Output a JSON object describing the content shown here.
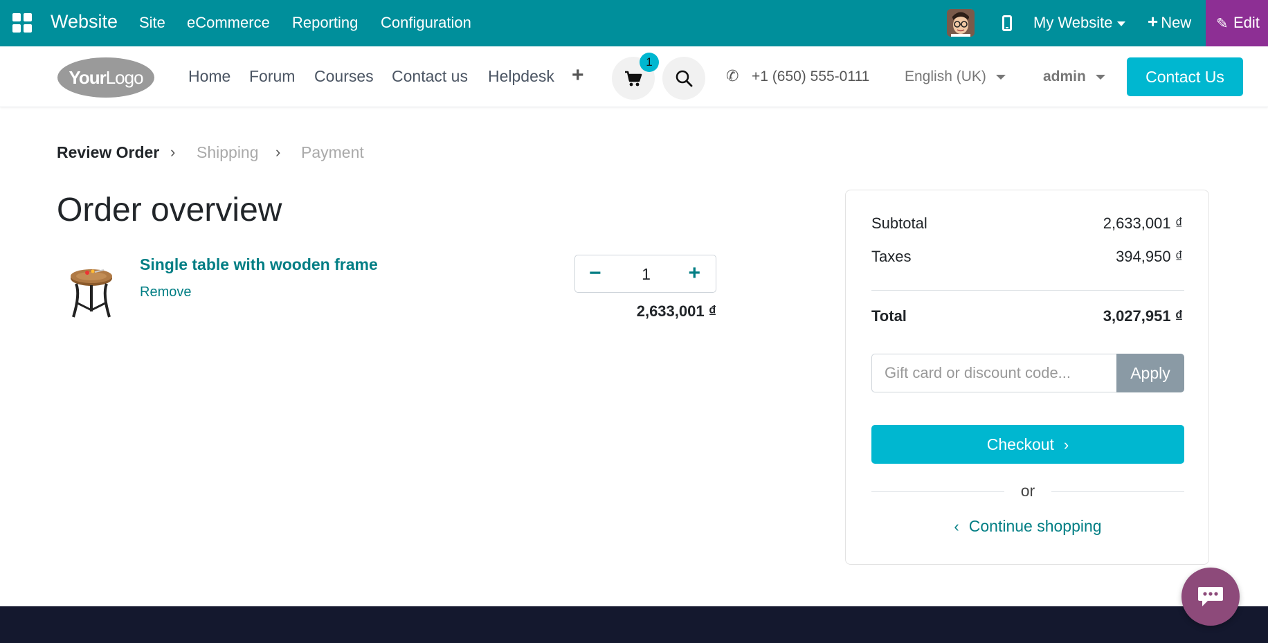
{
  "admin_bar": {
    "app_name": "Website",
    "menu": [
      "Site",
      "eCommerce",
      "Reporting",
      "Configuration"
    ],
    "website_selector": "My Website",
    "new_label": "New",
    "edit_label": "Edit",
    "colors": {
      "bar": "#008f9b",
      "edit": "#8d2f94"
    }
  },
  "header": {
    "logo_text": "YourLogo",
    "nav": [
      "Home",
      "Forum",
      "Courses",
      "Contact us",
      "Helpdesk"
    ],
    "cart_count": "1",
    "phone": "+1 (650) 555-0111",
    "language": "English (UK)",
    "user": "admin",
    "contact_button": "Contact Us"
  },
  "breadcrumb": {
    "steps": [
      "Review Order",
      "Shipping",
      "Payment"
    ],
    "active_index": 0
  },
  "order": {
    "title": "Order overview",
    "lines": [
      {
        "product_name": "Single table with wooden frame",
        "remove_label": "Remove",
        "quantity": "1",
        "price": "2,633,001 ₫"
      }
    ]
  },
  "summary": {
    "subtotal_label": "Subtotal",
    "subtotal_value": "2,633,001 ₫",
    "taxes_label": "Taxes",
    "taxes_value": "394,950 ₫",
    "total_label": "Total",
    "total_value": "3,027,951 ₫",
    "discount_placeholder": "Gift card or discount code...",
    "apply_label": "Apply",
    "checkout_label": "Checkout",
    "or_label": "or",
    "continue_label": "Continue shopping"
  },
  "icons": {
    "apps": "apps-grid-icon",
    "mobile": "mobile-phone-icon",
    "cart": "shopping-cart-icon",
    "search": "search-icon",
    "phone": "phone-icon",
    "chat": "chat-bubble-icon"
  },
  "colors": {
    "accent": "#00b7d0",
    "link": "#017e84",
    "footer": "#14182e"
  }
}
